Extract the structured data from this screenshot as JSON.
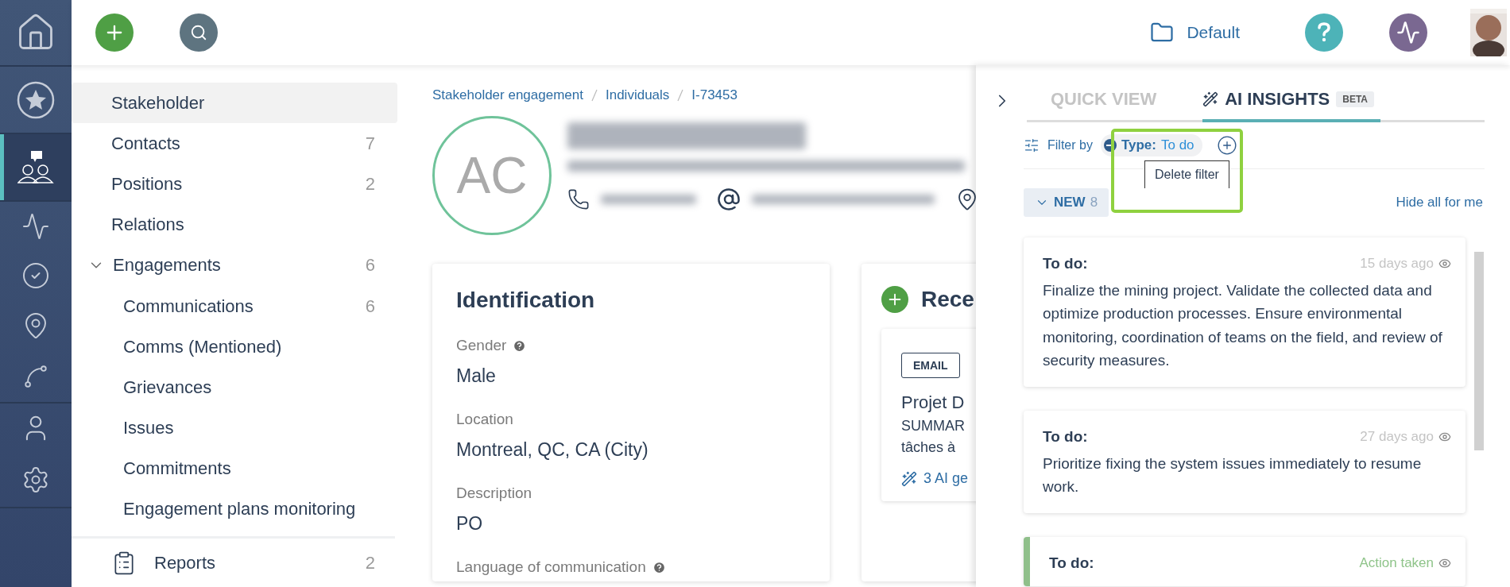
{
  "rail": [
    {
      "selected": false
    },
    {
      "selected": false
    },
    {
      "selected": true
    },
    {
      "selected": false
    },
    {
      "selected": false
    },
    {
      "selected": false
    },
    {
      "selected": false
    },
    {
      "selected": false
    },
    {
      "selected": false
    }
  ],
  "topbar": {
    "workspace": "Default"
  },
  "nav": {
    "items": [
      {
        "label": "Stakeholder",
        "selected": true
      },
      {
        "label": "Contacts",
        "count": "7",
        "selected": false
      },
      {
        "label": "Positions",
        "count": "2",
        "selected": false
      },
      {
        "label": "Relations",
        "selected": false
      },
      {
        "label": "Engagements",
        "count": "6",
        "selected": false,
        "expanded": true,
        "children": [
          {
            "label": "Communications",
            "count": "6",
            "selected": false
          },
          {
            "label": "Comms (Mentioned)",
            "selected": false
          },
          {
            "label": "Grievances",
            "selected": false
          },
          {
            "label": "Issues",
            "selected": false
          },
          {
            "label": "Commitments",
            "selected": false
          },
          {
            "label": "Engagement plans monitoring",
            "selected": false
          }
        ]
      }
    ],
    "footer": {
      "label": "Reports",
      "count": "2"
    }
  },
  "breadcrumb": [
    "Stakeholder engagement",
    "Individuals",
    "I-73453"
  ],
  "profile": {
    "initials": "AC"
  },
  "identification": {
    "title": "Identification",
    "fields": [
      {
        "label": "Gender",
        "help": true,
        "value": "Male"
      },
      {
        "label": "Location",
        "help": false,
        "value": "Montreal, QC, CA (City)"
      },
      {
        "label": "Description",
        "help": false,
        "value": "PO"
      },
      {
        "label": "Language of communication",
        "help": true
      }
    ]
  },
  "recent": {
    "title": "Rece",
    "items": [
      {
        "tag": "EMAIL",
        "title": "Projet D",
        "lines": [
          "SUMMAR",
          "tâches à"
        ],
        "ai_link": "3 AI ge"
      }
    ]
  },
  "panel": {
    "tabs": [
      {
        "label": "QUICK VIEW",
        "selected": false
      },
      {
        "label": "AI INSIGHTS",
        "badge": "BETA",
        "selected": true
      }
    ],
    "filter": {
      "label": "Filter by",
      "key": "Type:",
      "value": "To do",
      "highlighted": true,
      "tooltip": "Delete filter"
    },
    "group": {
      "label": "NEW",
      "count": "8",
      "expanded": true
    },
    "hide_all": "Hide all for me",
    "insights": [
      {
        "type": "To do:",
        "time": "15 days ago",
        "text": "Finalize the mining project. Validate the collected data and optimize production processes. Ensure environmental monitoring, coordination of teams on the field, and review of security measures.",
        "action_taken": false
      },
      {
        "type": "To do:",
        "time": "27 days ago",
        "text": "Prioritize fixing the system issues immediately to resume work.",
        "action_taken": false
      },
      {
        "type": "To do:",
        "time": "Action taken",
        "action_taken": true
      }
    ]
  }
}
